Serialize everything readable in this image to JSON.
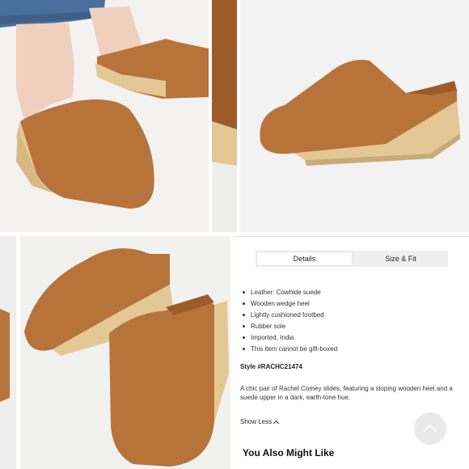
{
  "tabs": {
    "details_label": "Details",
    "size_fit_label": "Size & Fit"
  },
  "details": {
    "bullets": [
      "Leather: Cowhide suede",
      "Wooden wedge heel",
      "Lightly cushioned footbed",
      "Rubber sole",
      "Imported, India",
      "This item cannot be gift-boxed"
    ],
    "style_line": "Style #RACHC21474",
    "description": "A chic pair of Rachel Comey slides, featuring a sloping wooden heel and a suede upper in a dark, earth-tone hue.",
    "show_less_label": "Show Less"
  },
  "recommendations": {
    "heading": "You Also Might Like"
  },
  "colors": {
    "suede": "#b8733b",
    "suede_dark": "#9c5c2a",
    "wood": "#e3c895",
    "denim": "#4a6f9c",
    "skin": "#f0cfbe"
  }
}
